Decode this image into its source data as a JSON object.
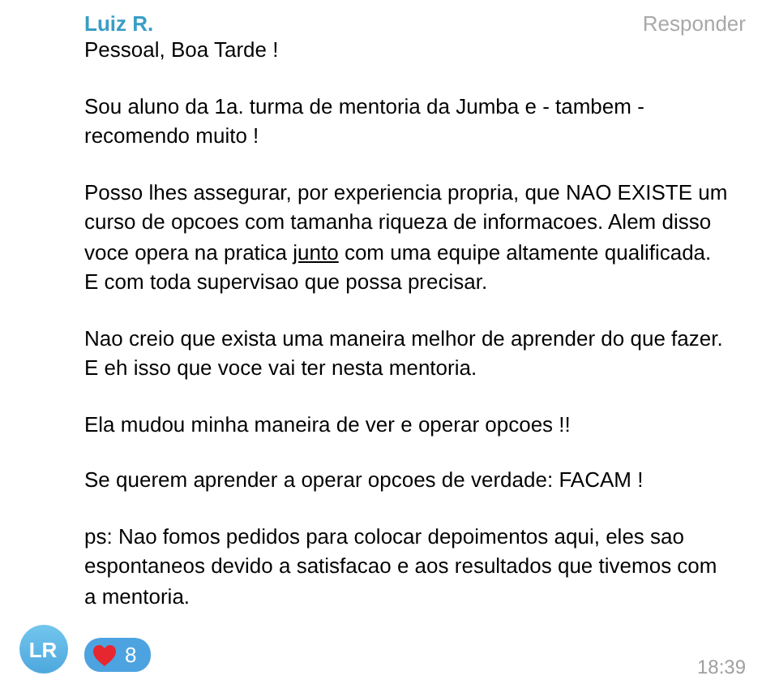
{
  "message": {
    "author": "Luiz R.",
    "reply_action": "Responder",
    "paragraphs": [
      {
        "lines": [
          [
            {
              "text": "Pessoal, Boa Tarde !",
              "underline": false
            }
          ]
        ]
      },
      {
        "lines": [
          [
            {
              "text": "Sou aluno da 1a. turma de mentoria da Jumba e - tambem -",
              "underline": false
            }
          ],
          [
            {
              "text": "recomendo muito !",
              "underline": false
            }
          ]
        ]
      },
      {
        "lines": [
          [
            {
              "text": "Posso lhes assegurar, por experiencia propria, que NAO EXISTE um",
              "underline": false
            }
          ],
          [
            {
              "text": "curso de opcoes com tamanha riqueza de informacoes. Alem disso",
              "underline": false
            }
          ],
          [
            {
              "text": "voce opera na pratica ",
              "underline": false
            },
            {
              "text": "junto",
              "underline": true
            },
            {
              "text": " com uma equipe altamente qualificada.",
              "underline": false
            }
          ],
          [
            {
              "text": "E com toda supervisao que possa precisar.",
              "underline": false
            }
          ]
        ]
      },
      {
        "lines": [
          [
            {
              "text": "Nao creio que exista uma maneira melhor de aprender do que fazer.",
              "underline": false
            }
          ],
          [
            {
              "text": "E eh isso que voce vai ter nesta mentoria.",
              "underline": false
            }
          ]
        ]
      },
      {
        "lines": [
          [
            {
              "text": "Ela mudou minha maneira de ver e operar opcoes !!",
              "underline": false
            }
          ]
        ]
      },
      {
        "lines": [
          [
            {
              "text": "Se querem aprender a operar opcoes de verdade: FACAM !",
              "underline": false
            }
          ]
        ]
      },
      {
        "lines": [
          [
            {
              "text": "ps: Nao fomos pedidos para colocar depoimentos aqui, eles sao",
              "underline": false
            }
          ],
          [
            {
              "text": "espontaneos devido a satisfacao e aos resultados que tivemos com",
              "underline": false
            }
          ],
          [
            {
              "text": "a mentoria.",
              "underline": false
            }
          ]
        ]
      }
    ],
    "avatar_initials": "LR",
    "reactions": [
      {
        "count": "8",
        "selected": true
      }
    ],
    "time": "18:39"
  }
}
